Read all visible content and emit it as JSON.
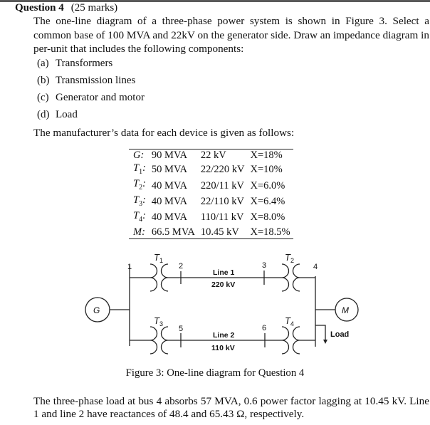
{
  "question": {
    "number_label": "Question 4",
    "marks_label": "(25 marks)",
    "intro": "The one-line diagram of a three-phase power system is shown in Figure 3. Select a common base of 100 MVA and 22kV on the generator side. Draw an impedance diagram in per-unit that includes the following components:",
    "components": [
      {
        "label": "(a)",
        "text": "Transformers"
      },
      {
        "label": "(b)",
        "text": "Transmission lines"
      },
      {
        "label": "(c)",
        "text": "Generator and motor"
      },
      {
        "label": "(d)",
        "text": "Load"
      }
    ],
    "data_intro": "The manufacturer’s data for each device is given as follows:",
    "devices": [
      {
        "name": "G",
        "sub": "",
        "rating": "90 MVA",
        "voltage": "22 kV",
        "reactance": "X=18%"
      },
      {
        "name": "T",
        "sub": "1",
        "rating": "50 MVA",
        "voltage": "22/220 kV",
        "reactance": "X=10%"
      },
      {
        "name": "T",
        "sub": "2",
        "rating": "40 MVA",
        "voltage": "220/11 kV",
        "reactance": "X=6.0%"
      },
      {
        "name": "T",
        "sub": "3",
        "rating": "40 MVA",
        "voltage": "22/110 kV",
        "reactance": "X=6.4%"
      },
      {
        "name": "T",
        "sub": "4",
        "rating": "40 MVA",
        "voltage": "110/11 kV",
        "reactance": "X=8.0%"
      },
      {
        "name": "M",
        "sub": "",
        "rating": "66.5 MVA",
        "voltage": "10.45 kV",
        "reactance": "X=18.5%"
      }
    ],
    "figure_caption": "Figure 3: One-line diagram for Question 4",
    "closing": "The three-phase load at bus 4 absorbs 57 MVA, 0.6 power factor lagging at 10.45 kV. Line 1 and line 2 have reactances of 48.4 and 65.43 Ω, respectively."
  },
  "diagram": {
    "buses": [
      "1",
      "2",
      "3",
      "4",
      "5",
      "6"
    ],
    "transformers": [
      "T1",
      "T2",
      "T3",
      "T4"
    ],
    "generator_label": "G",
    "motor_label": "M",
    "load_label": "Load",
    "line1_name": "Line 1",
    "line1_voltage": "220 kV",
    "line2_name": "Line 2",
    "line2_voltage": "110 kV"
  }
}
